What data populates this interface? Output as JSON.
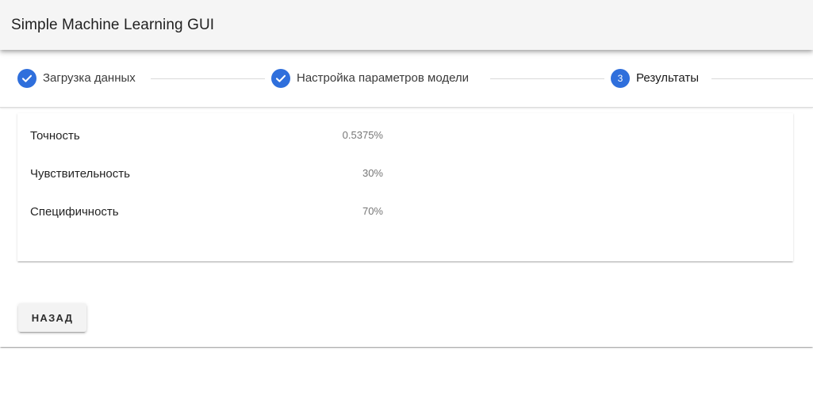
{
  "app": {
    "title": "Simple Machine Learning GUI"
  },
  "stepper": {
    "steps": [
      {
        "label": "Загрузка данных",
        "state": "completed",
        "icon": "check-icon"
      },
      {
        "label": "Настройка параметров модели",
        "state": "completed",
        "icon": "check-icon"
      },
      {
        "label": "Результаты",
        "state": "active",
        "number": "3"
      }
    ],
    "accent_color": "#2f6fdc"
  },
  "results": {
    "metrics": [
      {
        "name": "Точность",
        "value": "0.5375%"
      },
      {
        "name": "Чувствительность",
        "value": "30%"
      },
      {
        "name": "Специфичность",
        "value": "70%"
      }
    ]
  },
  "actions": {
    "back_label": "НАЗАД"
  }
}
